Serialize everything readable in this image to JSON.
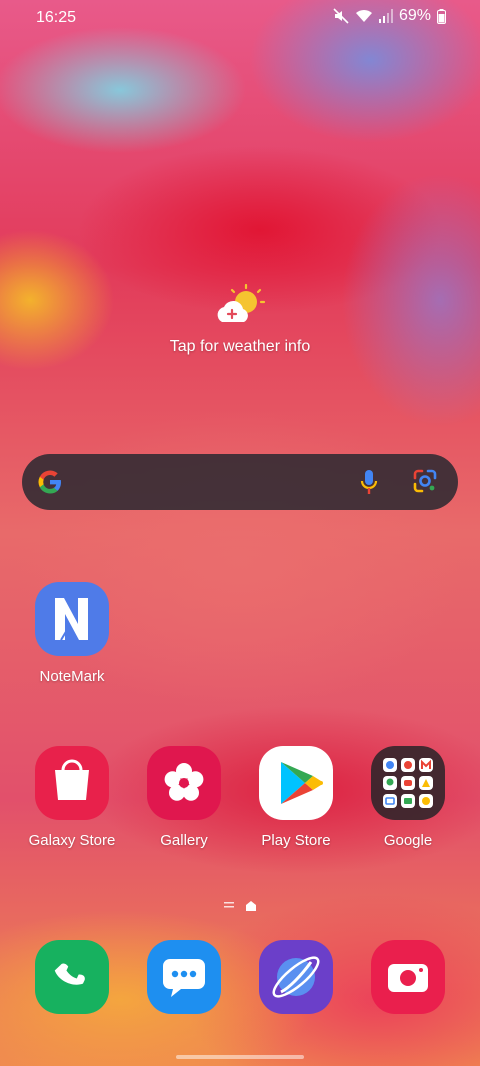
{
  "status_bar": {
    "time": "16:25",
    "battery": "69%"
  },
  "weather": {
    "text": "Tap for weather info"
  },
  "apps": {
    "notemark": "NoteMark",
    "galaxy_store": "Galaxy Store",
    "gallery": "Gallery",
    "play_store": "Play Store",
    "google": "Google"
  },
  "icons": [
    "mute-icon",
    "wifi-icon",
    "signal-icon",
    "battery-icon",
    "weather-cloud-sun-icon",
    "google-g-icon",
    "mic-icon",
    "google-lens-icon",
    "phone-icon",
    "messages-icon",
    "internet-icon",
    "camera-icon"
  ]
}
